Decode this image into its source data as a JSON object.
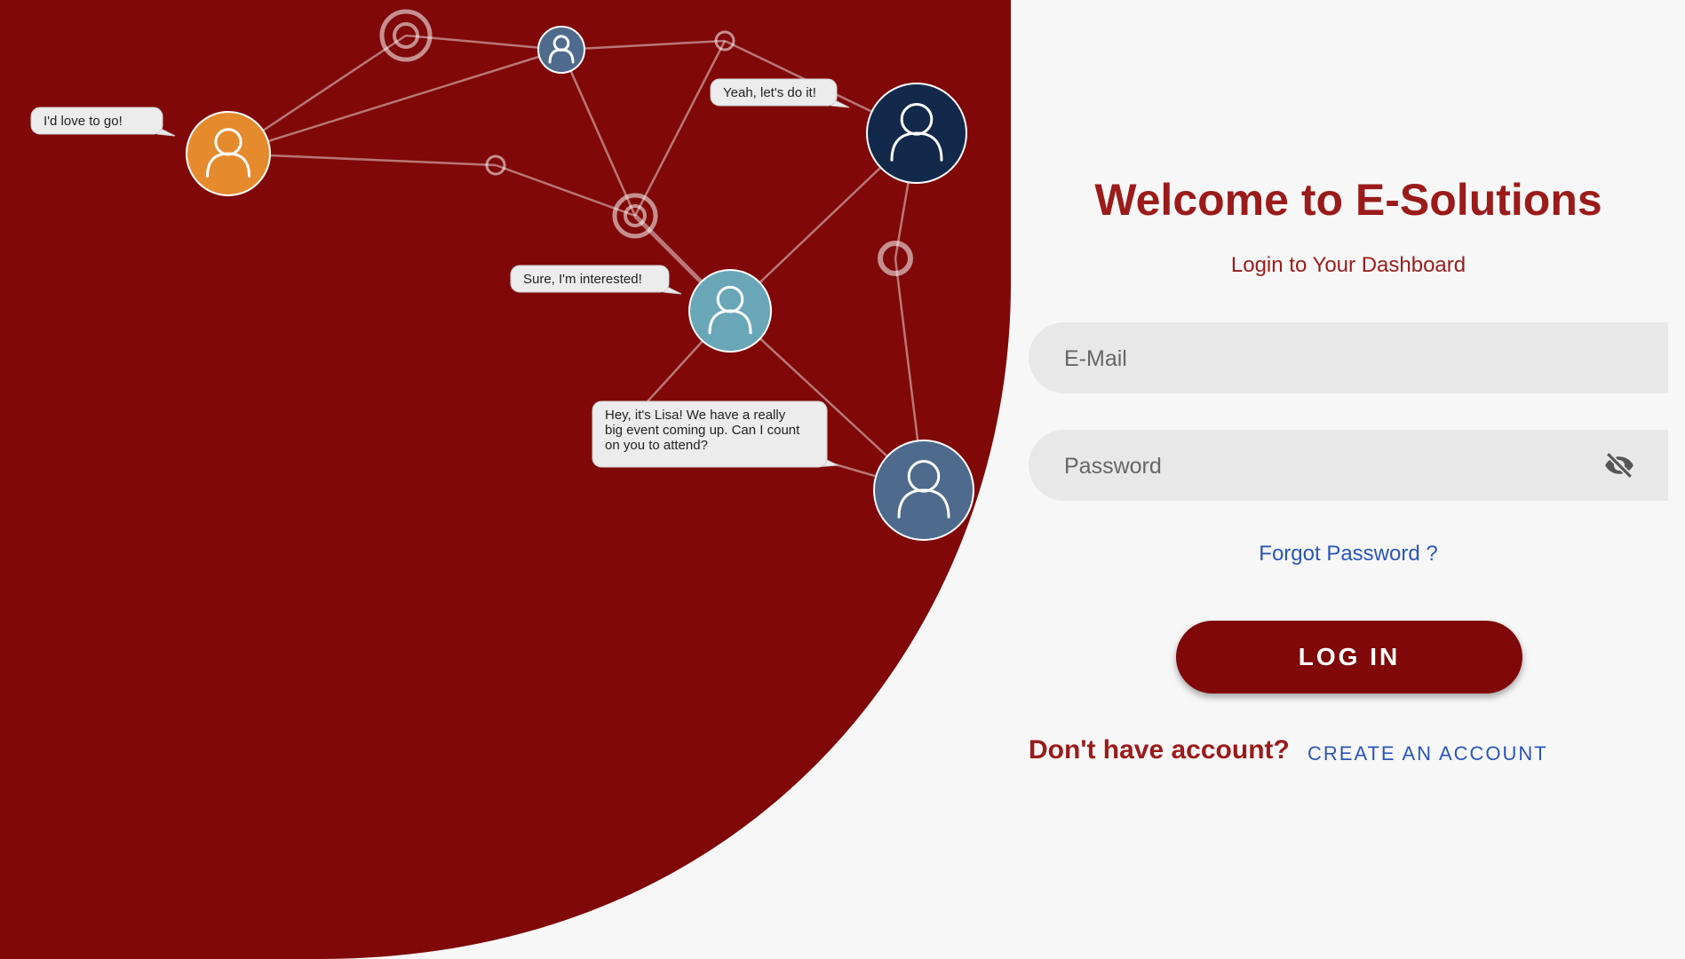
{
  "colors": {
    "brand_red": "#800808",
    "title_red": "#9b1b1b",
    "link_blue": "#2a56b8",
    "field_bg": "#e8e8e8",
    "page_bg": "#f7f7f7"
  },
  "illustration": {
    "bubbles": [
      "I'd love to go!",
      "Yeah, let's do it!",
      "Sure, I'm interested!",
      "Hey, it's Lisa! We have a really",
      "big event coming up. Can I count",
      "on you to attend?"
    ],
    "avatar_icon": "person-outline-icon"
  },
  "login": {
    "title": "Welcome to E-Solutions",
    "subtitle": "Login to Your Dashboard",
    "email_placeholder": "E-Mail",
    "password_placeholder": "Password",
    "password_toggle_icon": "eye-off-icon",
    "forgot_label": "Forgot Password ?",
    "login_label": "LOG IN",
    "signup_prompt": "Don't have account?",
    "create_account_label": "CREATE AN ACCOUNT"
  }
}
